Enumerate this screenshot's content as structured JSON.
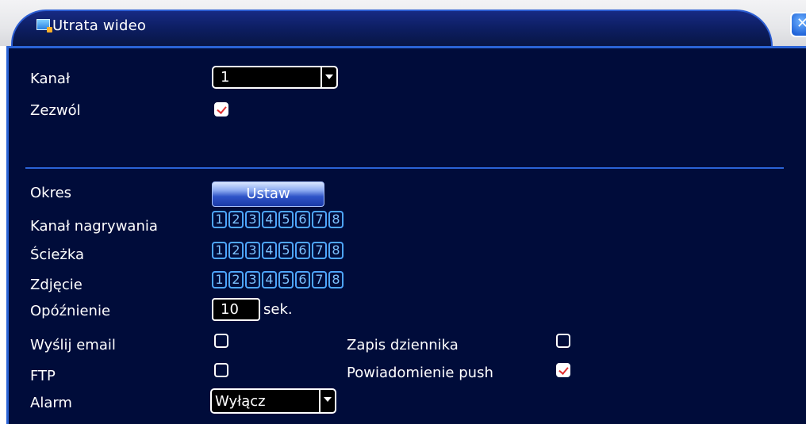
{
  "window": {
    "title": "Utrata wideo",
    "close_icon": "close-icon"
  },
  "form": {
    "channel": {
      "label": "Kanał",
      "value": "1"
    },
    "enable": {
      "label": "Zezwól",
      "checked": true
    },
    "period": {
      "label": "Okres",
      "button_label": "Ustaw"
    },
    "record_channel": {
      "label": "Kanał nagrywania",
      "channels": [
        "1",
        "2",
        "3",
        "4",
        "5",
        "6",
        "7",
        "8"
      ]
    },
    "tour": {
      "label": "Ścieżka",
      "channels": [
        "1",
        "2",
        "3",
        "4",
        "5",
        "6",
        "7",
        "8"
      ]
    },
    "snapshot": {
      "label": "Zdjęcie",
      "channels": [
        "1",
        "2",
        "3",
        "4",
        "5",
        "6",
        "7",
        "8"
      ]
    },
    "delay": {
      "label": "Opóźnienie",
      "value": "10",
      "unit": "sek."
    },
    "send_email": {
      "label": "Wyślij email",
      "checked": false
    },
    "log": {
      "label": "Zapis dziennika",
      "checked": false
    },
    "ftp": {
      "label": "FTP",
      "checked": false
    },
    "push": {
      "label": "Powiadomienie push",
      "checked": true
    },
    "alarm": {
      "label": "Alarm",
      "value": "Wyłącz"
    }
  },
  "colors": {
    "panel_bg": "#000c3a",
    "accent_border": "#2a63d6",
    "channel_digit": "#7ec3ff",
    "check_mark": "#e23030"
  }
}
